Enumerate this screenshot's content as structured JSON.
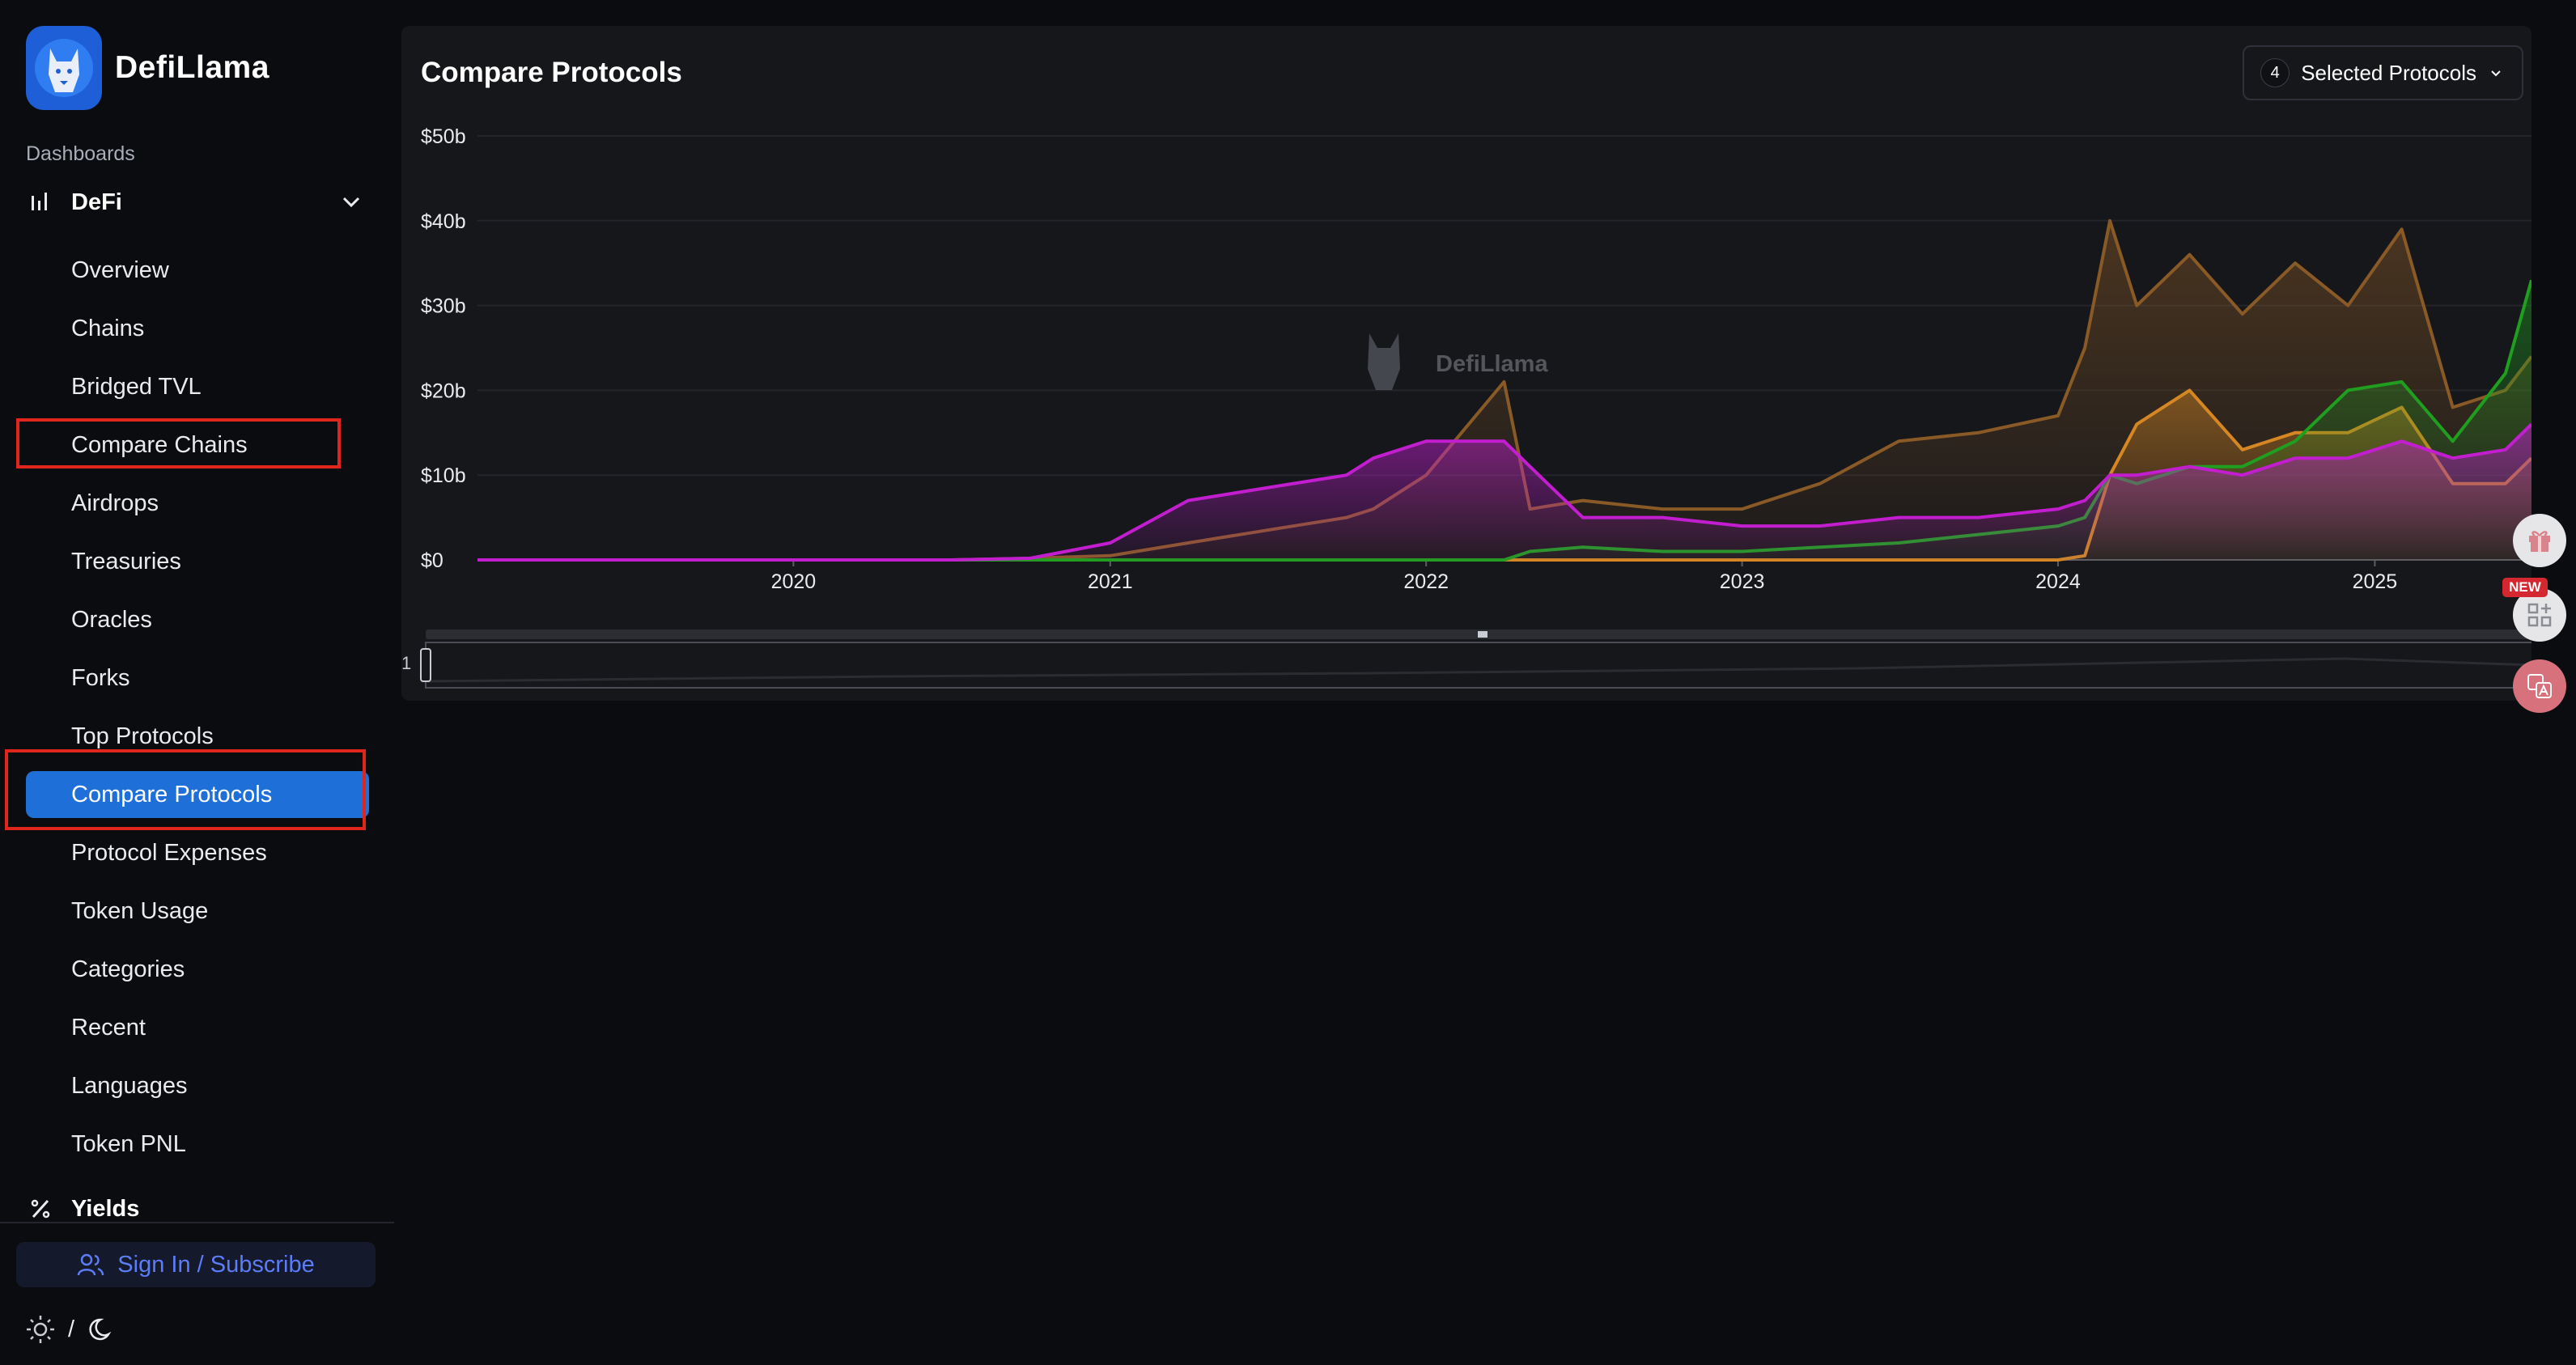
{
  "brand": {
    "name": "DefiLlama"
  },
  "sidebar": {
    "section_label": "Dashboards",
    "group": {
      "label": "DeFi",
      "icon": "bar-chart-icon",
      "expanded": true
    },
    "items": [
      {
        "label": "Overview"
      },
      {
        "label": "Chains"
      },
      {
        "label": "Bridged TVL"
      },
      {
        "label": "Compare Chains",
        "highlighted": true
      },
      {
        "label": "Airdrops"
      },
      {
        "label": "Treasuries"
      },
      {
        "label": "Oracles"
      },
      {
        "label": "Forks"
      },
      {
        "label": "Top Protocols"
      },
      {
        "label": "Compare Protocols",
        "active": true,
        "highlighted": true
      },
      {
        "label": "Protocol Expenses"
      },
      {
        "label": "Token Usage"
      },
      {
        "label": "Categories"
      },
      {
        "label": "Recent"
      },
      {
        "label": "Languages"
      },
      {
        "label": "Token PNL"
      }
    ],
    "next_group": {
      "label": "Yields",
      "icon": "percent-icon"
    },
    "sign_in": "Sign In / Subscribe",
    "theme_separator": "/"
  },
  "main": {
    "title": "Compare Protocols",
    "selector": {
      "count": "4",
      "label": "Selected Protocols"
    },
    "watermark": "DefiLlama",
    "slider_label": "1",
    "new_badge": "NEW"
  },
  "colors": {
    "background": "#0b0c0f",
    "panel": "#16171b",
    "accent": "#1f6fd9",
    "highlight_border": "#e0251c",
    "series_brown": "#8a5a26",
    "series_orange": "#d68722",
    "series_green": "#1f9e1f",
    "series_magenta": "#c21ed0"
  },
  "chart_data": {
    "type": "area",
    "title": "",
    "xlabel": "",
    "ylabel": "",
    "x_ticks": [
      "2020",
      "2021",
      "2022",
      "2023",
      "2024",
      "2025"
    ],
    "y_ticks": [
      "$0",
      "$10b",
      "$20b",
      "$30b",
      "$40b",
      "$50b"
    ],
    "ylim": [
      0,
      50
    ],
    "y_unit": "billions USD",
    "grid": true,
    "legend": "none",
    "x": [
      "2019-01",
      "2020-01",
      "2020-07",
      "2020-10",
      "2021-01",
      "2021-04",
      "2021-07",
      "2021-10",
      "2021-11",
      "2022-01",
      "2022-04",
      "2022-05",
      "2022-07",
      "2022-10",
      "2023-01",
      "2023-04",
      "2023-07",
      "2023-10",
      "2024-01",
      "2024-02",
      "2024-03",
      "2024-04",
      "2024-06",
      "2024-08",
      "2024-10",
      "2024-12",
      "2025-02",
      "2025-04",
      "2025-06",
      "2025-07"
    ],
    "series": [
      {
        "color": "#8a5a26",
        "values": [
          0,
          0,
          0,
          0.2,
          0.5,
          2,
          3.5,
          5,
          6,
          10,
          21,
          6,
          7,
          6,
          6,
          9,
          14,
          15,
          17,
          25,
          40,
          30,
          36,
          29,
          35,
          30,
          39,
          18,
          20,
          24
        ]
      },
      {
        "color": "#d68722",
        "values": [
          0,
          0,
          0,
          0,
          0,
          0,
          0,
          0,
          0,
          0,
          0,
          0,
          0,
          0,
          0,
          0,
          0,
          0,
          0,
          0.5,
          10,
          16,
          20,
          13,
          15,
          15,
          18,
          9,
          9,
          12
        ]
      },
      {
        "color": "#1f9e1f",
        "values": [
          0,
          0,
          0,
          0,
          0,
          0,
          0,
          0,
          0,
          0,
          0,
          1,
          1.5,
          1,
          1,
          1.5,
          2,
          3,
          4,
          5,
          10,
          9,
          11,
          11,
          14,
          20,
          21,
          14,
          22,
          33
        ]
      },
      {
        "color": "#c21ed0",
        "values": [
          0,
          0,
          0,
          0.2,
          2,
          7,
          8.5,
          10,
          12,
          14,
          14,
          11,
          5,
          5,
          4,
          4,
          5,
          5,
          6,
          7,
          10,
          10,
          11,
          10,
          12,
          12,
          14,
          12,
          13,
          16
        ]
      }
    ]
  }
}
